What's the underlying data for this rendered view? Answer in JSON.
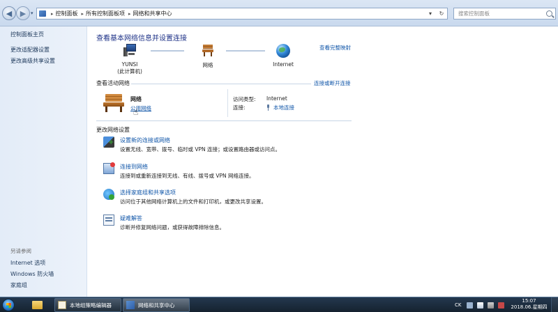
{
  "addressbar": {
    "breadcrumbs": [
      "控制面板",
      "所有控制面板项",
      "网络和共享中心"
    ],
    "search_placeholder": "搜索控制面板"
  },
  "sidebar": {
    "links": [
      "控制面板主页",
      "更改适配器设置",
      "更改高级共享设置"
    ],
    "see_also_header": "另请参阅",
    "see_also": [
      "Internet 选项",
      "Windows 防火墙",
      "家庭组"
    ]
  },
  "main": {
    "title": "查看基本网络信息并设置连接",
    "full_map_link": "查看完整映射",
    "map": {
      "computer_name": "YUNSI",
      "computer_sub": "(此计算机)",
      "network_label": "网络",
      "internet_label": "Internet"
    },
    "active_networks_header": "查看活动网络",
    "connect_disconnect_link": "连接或断开连接",
    "network": {
      "name": "网络",
      "type_link": "公用网络",
      "access_type_label": "访问类型:",
      "access_type_value": "Internet",
      "connections_label": "连接:",
      "connections_value": "本地连接"
    },
    "change_settings_header": "更改网络设置",
    "tasks": [
      {
        "title": "设置新的连接或网络",
        "desc": "设置无线、宽带、拨号、临时或 VPN 连接；或设置路由器或访问点。"
      },
      {
        "title": "连接到网络",
        "desc": "连接到或重新连接到无线、有线、拨号或 VPN 网络连接。"
      },
      {
        "title": "选择家庭组和共享选项",
        "desc": "访问位于其他网络计算机上的文件和打印机，或更改共享设置。"
      },
      {
        "title": "疑难解答",
        "desc": "诊断并修复网络问题，或获得故障排除信息。"
      }
    ]
  },
  "taskbar": {
    "tasks": [
      "本地组策略编辑器",
      "网络和共享中心"
    ],
    "ime": "CK",
    "time": "15:07",
    "date": "2018.06.星期四"
  }
}
